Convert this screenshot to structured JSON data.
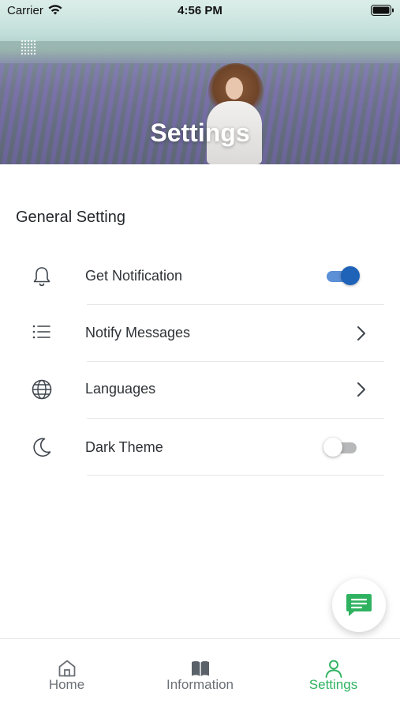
{
  "status_bar": {
    "carrier": "Carrier",
    "time": "4:56 PM"
  },
  "header": {
    "title": "Settings"
  },
  "section": {
    "title": "General Setting"
  },
  "settings": [
    {
      "label": "Get Notification",
      "icon": "bell-icon",
      "control": "toggle",
      "value": true
    },
    {
      "label": "Notify Messages",
      "icon": "list-icon",
      "control": "chevron"
    },
    {
      "label": "Languages",
      "icon": "globe-icon",
      "control": "chevron"
    },
    {
      "label": "Dark Theme",
      "icon": "moon-icon",
      "control": "toggle",
      "value": false
    }
  ],
  "tabs": [
    {
      "label": "Home",
      "icon": "home-icon",
      "active": false
    },
    {
      "label": "Information",
      "icon": "book-icon",
      "active": false
    },
    {
      "label": "Settings",
      "icon": "person-icon",
      "active": true
    }
  ],
  "colors": {
    "accent_green": "#2fb260",
    "toggle_blue": "#1e63b8"
  }
}
